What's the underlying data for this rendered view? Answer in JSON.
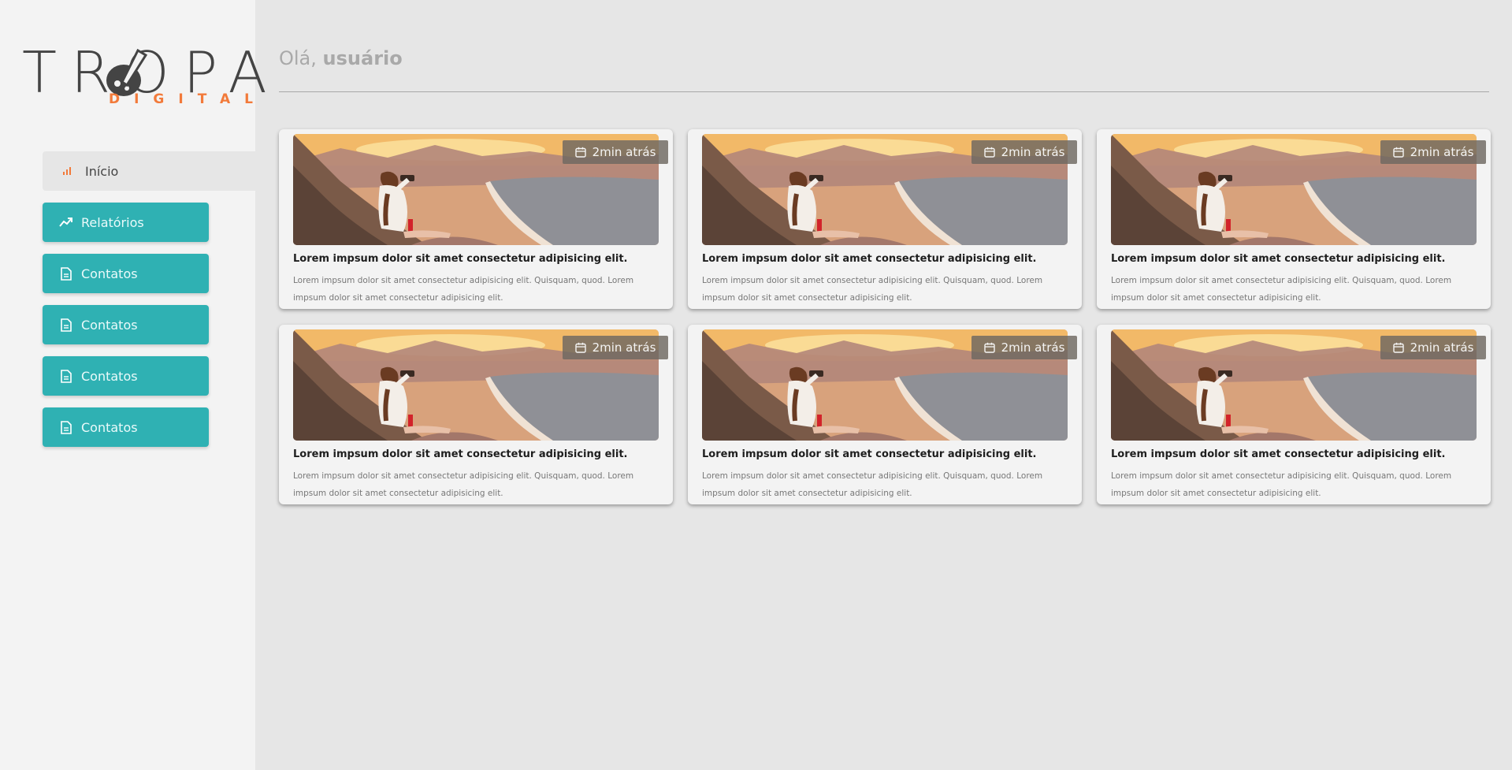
{
  "brand": {
    "name": "TROPA",
    "tagline": "DIGITAL",
    "accent": "#f27a3a"
  },
  "sidebar": {
    "items": [
      {
        "label": "Início",
        "icon": "bar-chart-icon",
        "active": true
      },
      {
        "label": "Relatórios",
        "icon": "trending-up-icon"
      },
      {
        "label": "Contatos",
        "icon": "document-icon"
      },
      {
        "label": "Contatos",
        "icon": "document-icon"
      },
      {
        "label": "Contatos",
        "icon": "document-icon"
      },
      {
        "label": "Contatos",
        "icon": "document-icon"
      }
    ],
    "button_color": "#2fb1b3"
  },
  "header": {
    "greeting": "Olá,",
    "username": "usuário"
  },
  "cards": [
    {
      "time": "2min atrás",
      "title": "Lorem impsum dolor sit amet consectetur adipisicing elit.",
      "description": "Lorem impsum dolor sit amet consectetur adipisicing elit. Quisquam, quod. Lorem impsum dolor sit amet consectetur adipisicing elit."
    },
    {
      "time": "2min atrás",
      "title": "Lorem impsum dolor sit amet consectetur adipisicing elit.",
      "description": "Lorem impsum dolor sit amet consectetur adipisicing elit. Quisquam, quod. Lorem impsum dolor sit amet consectetur adipisicing elit."
    },
    {
      "time": "2min atrás",
      "title": "Lorem impsum dolor sit amet consectetur adipisicing elit.",
      "description": "Lorem impsum dolor sit amet consectetur adipisicing elit. Quisquam, quod. Lorem impsum dolor sit amet consectetur adipisicing elit."
    },
    {
      "time": "2min atrás",
      "title": "Lorem impsum dolor sit amet consectetur adipisicing elit.",
      "description": "Lorem impsum dolor sit amet consectetur adipisicing elit. Quisquam, quod. Lorem impsum dolor sit amet consectetur adipisicing elit."
    },
    {
      "time": "2min atrás",
      "title": "Lorem impsum dolor sit amet consectetur adipisicing elit.",
      "description": "Lorem impsum dolor sit amet consectetur adipisicing elit. Quisquam, quod. Lorem impsum dolor sit amet consectetur adipisicing elit."
    },
    {
      "time": "2min atrás",
      "title": "Lorem impsum dolor sit amet consectetur adipisicing elit.",
      "description": "Lorem impsum dolor sit amet consectetur adipisicing elit. Quisquam, quod. Lorem impsum dolor sit amet consectetur adipisicing elit."
    }
  ]
}
